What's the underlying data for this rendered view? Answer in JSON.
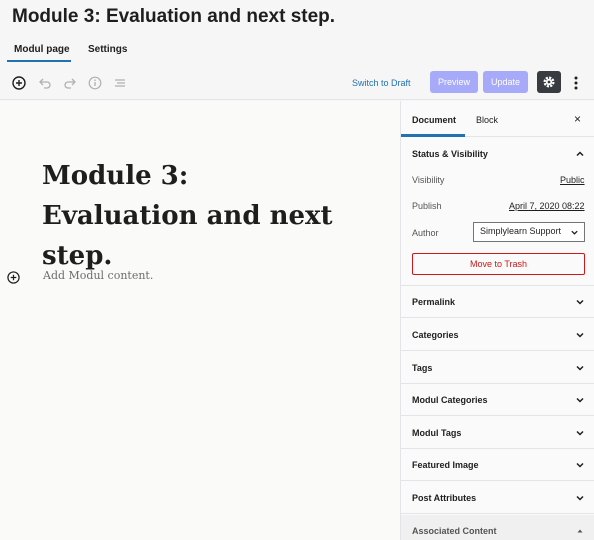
{
  "page": {
    "title": "Module 3: Evaluation and next step."
  },
  "tabs": [
    {
      "label": "Modul page"
    },
    {
      "label": "Settings"
    }
  ],
  "toolbar": {
    "icons": [
      "add-block-icon",
      "undo-icon",
      "redo-icon",
      "info-icon",
      "list-view-icon"
    ],
    "switch_draft": "Switch to Draft",
    "preview": "Preview",
    "update": "Update"
  },
  "editor": {
    "post_title": "Module 3: Evaluation and next step.",
    "placeholder": "Add Modul content."
  },
  "sidebar": {
    "tabs": {
      "document": "Document",
      "block": "Block",
      "close": "×"
    },
    "status": {
      "title": "Status & Visibility",
      "visibility_label": "Visibility",
      "visibility_value": "Public",
      "publish_label": "Publish",
      "publish_value": "April 7, 2020 08:22",
      "author_label": "Author",
      "author_value": "Simplylearn Support",
      "trash": "Move to Trash"
    },
    "panels": [
      {
        "label": "Permalink"
      },
      {
        "label": "Categories"
      },
      {
        "label": "Tags"
      },
      {
        "label": "Modul Categories"
      },
      {
        "label": "Modul Tags"
      },
      {
        "label": "Featured Image"
      },
      {
        "label": "Post Attributes"
      },
      {
        "label": "Associated Content"
      }
    ]
  }
}
